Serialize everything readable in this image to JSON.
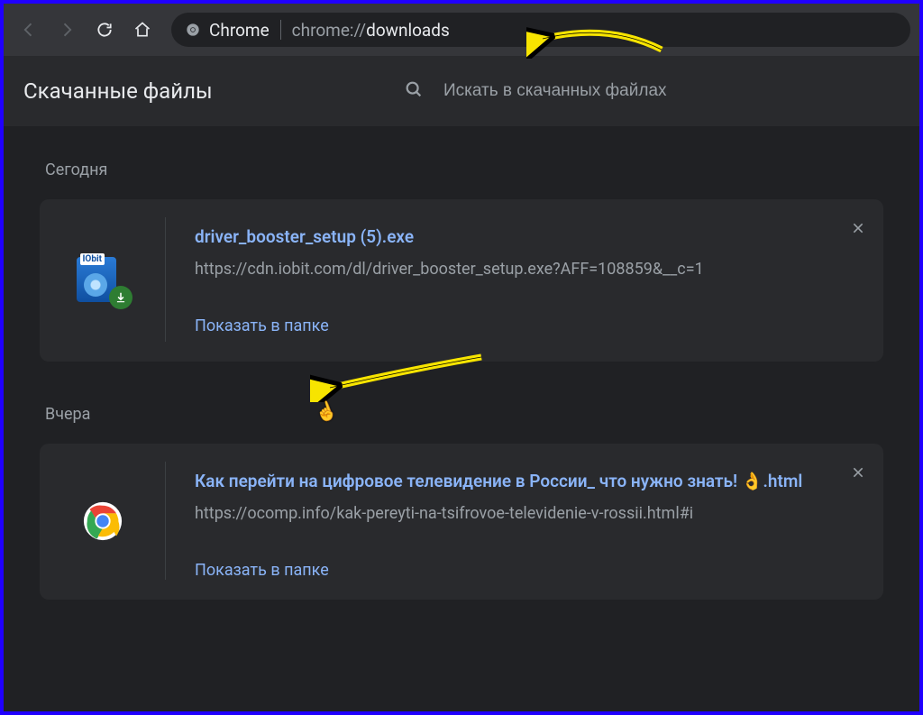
{
  "toolbar": {
    "chrome_label": "Chrome",
    "url_prefix": "chrome://",
    "url_path": "downloads"
  },
  "header": {
    "title": "Скачанные файлы",
    "search_placeholder": "Искать в скачанных файлах"
  },
  "sections": {
    "today": "Сегодня",
    "yesterday": "Вчера"
  },
  "downloads": {
    "item1": {
      "filename": "driver_booster_setup (5).exe",
      "url": "https://cdn.iobit.com/dl/driver_booster_setup.exe?AFF=108859&__c=1",
      "show_in_folder": "Показать в папке",
      "icon_label": "IObit"
    },
    "item2": {
      "filename": "Как перейти на цифровое телевидение в России_ что нужно знать! 👌.html",
      "url": "https://ocomp.info/kak-pereyti-na-tsifrovoe-televidenie-v-rossii.html#i",
      "show_in_folder": "Показать в папке"
    }
  }
}
